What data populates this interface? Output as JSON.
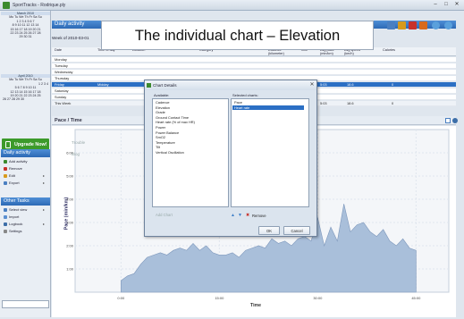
{
  "window": {
    "title": "SportTracks - Rodrique.ply",
    "min": "–",
    "max": "□",
    "close": "✕"
  },
  "caption": "The individual chart – Elevation",
  "calendar": [
    {
      "month": "March 2010",
      "days": "Mo Tu We Th Fr Sa Su",
      "rows": [
        "1 2 3 4 5 6 7",
        "8 9 10 11 12 13 14",
        "15 16 17 18 19 20 21",
        "22 23 24 25 26 27 28",
        "29 30 31"
      ]
    },
    {
      "month": "April 2010",
      "days": "Mo Tu We Th Fr Sa Su",
      "rows": [
        "1 2 3 4",
        "5 6 7 8 9 10 11",
        "12 13 14 15 16 17 18",
        "19 20 21 22 23 24 25",
        "26 27 28 29 30"
      ]
    }
  ],
  "upgrade_label": "Upgrade Now!",
  "daily_activity": {
    "header": "Daily activity",
    "items": [
      {
        "label": "Add activity"
      },
      {
        "label": "Remove"
      },
      {
        "label": "Edit"
      },
      {
        "label": "Export"
      }
    ]
  },
  "other_tasks": {
    "header": "Other Tasks",
    "items": [
      {
        "label": "Select view"
      },
      {
        "label": "Import"
      },
      {
        "label": "Logbook"
      },
      {
        "label": "Settings"
      }
    ]
  },
  "week_panel": {
    "header": "Daily activity",
    "week_of": "Week of 2010-03-01",
    "columns": [
      "Date",
      "Time of day",
      "Location",
      "Category",
      "Distance (kilometer)",
      "Time",
      "Avg pace (min/km)",
      "Avg speed (km/h)",
      "Calories"
    ],
    "days": [
      {
        "label": "Monday"
      },
      {
        "label": "Tuesday"
      },
      {
        "label": "Wednesday"
      },
      {
        "label": "Thursday"
      },
      {
        "label": "Friday",
        "time": "Midday",
        "dist": "3.41",
        "dur": "5:03",
        "pace": "18.6",
        "cal": "0",
        "selected": true
      },
      {
        "label": "Saturday"
      },
      {
        "label": "Sunday"
      },
      {
        "label": "This Week",
        "dist": "3.41",
        "dur": "5:03",
        "pace": "18.6",
        "cal": "0"
      }
    ]
  },
  "chart_section": {
    "header": "Pace / Time"
  },
  "chart_data": {
    "type": "area",
    "xlabel": "Time",
    "ylabel": "Pace (min/km)",
    "xticks": [
      "0:00",
      "15:00",
      "30:00",
      "45:00"
    ],
    "yticks": [
      "6:00",
      "5:00",
      "4:00",
      "3:00",
      "2:00",
      "1:00"
    ],
    "x": [
      0,
      1,
      2,
      3,
      4,
      5,
      6,
      7,
      8,
      9,
      10,
      11,
      12,
      13,
      14,
      15,
      16,
      17,
      18,
      19,
      20,
      21,
      22,
      23,
      24,
      25,
      26,
      27,
      28,
      29,
      30,
      31,
      32,
      33,
      34,
      35,
      36,
      37,
      38,
      39,
      40,
      41,
      42,
      43,
      44,
      45
    ],
    "values": [
      0.5,
      0.7,
      0.8,
      1.2,
      1.5,
      1.6,
      1.7,
      1.6,
      1.8,
      1.9,
      1.8,
      2.1,
      1.8,
      2.0,
      1.7,
      1.6,
      1.6,
      1.7,
      1.5,
      1.8,
      1.9,
      2.0,
      1.9,
      2.3,
      2.1,
      2.2,
      2.0,
      2.3,
      2.4,
      2.2,
      3.2,
      2.0,
      2.8,
      2.2,
      3.8,
      2.6,
      2.9,
      3.0,
      2.6,
      2.4,
      2.7,
      2.2,
      2.0,
      2.3,
      1.9,
      1.8
    ],
    "xlim": [
      -7,
      50
    ],
    "ylim": [
      0,
      7
    ]
  },
  "chart_overlay": {
    "line1": "Trouble",
    "line2": "Blog"
  },
  "dialog": {
    "title": "Chart Details",
    "available_label": "Available:",
    "selected_label": "Selected charts:",
    "available": [
      "Cadence",
      "Elevation",
      "Grade",
      "Ground Contact Time",
      "Heart rate (% of max HR)",
      "Power",
      "Power Balance",
      "SmO2",
      "Temperature",
      "Tilt",
      "Vertical Oscillation"
    ],
    "selected": [
      "Pace",
      "Heart rate"
    ],
    "add_label": "Add Chart",
    "remove_label": "Remove",
    "ok_label": "OK",
    "cancel_label": "Cancel"
  },
  "colors": {
    "accent": "#2b6fc4",
    "area_fill": "#a9bfda",
    "upgrade": "#3c9a2a"
  }
}
